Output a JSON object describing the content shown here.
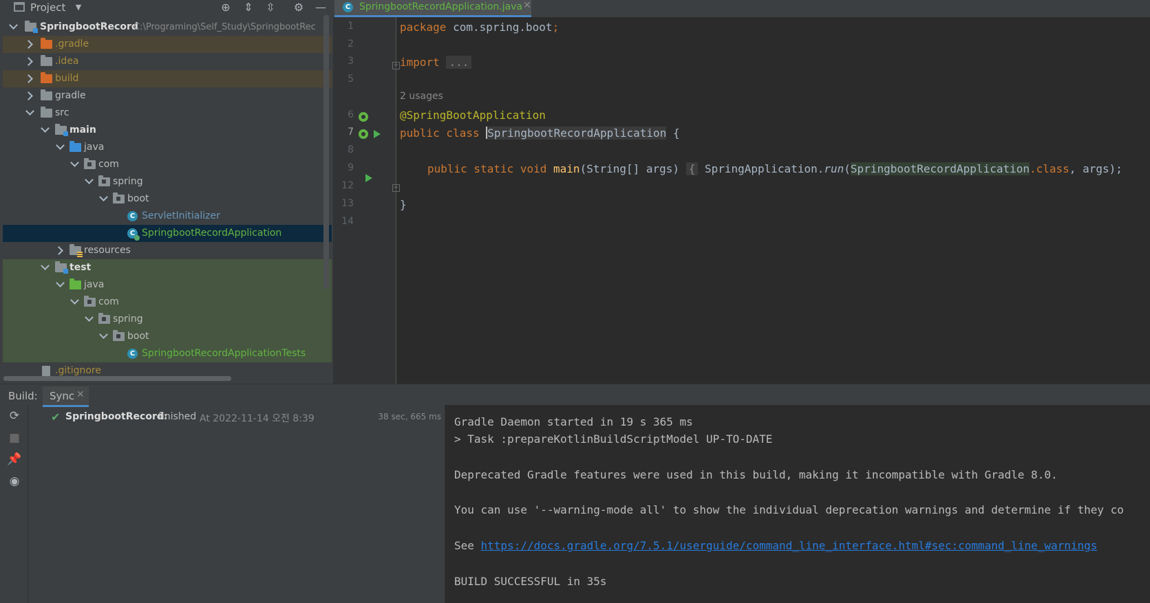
{
  "project_panel": {
    "title": "Project",
    "tree": {
      "root_name": "SpringbootRecord",
      "root_path": "C:\\Programing\\Self_Study\\SpringbootRec",
      "items": {
        "gradle_hidden": ".gradle",
        "idea": ".idea",
        "build": "build",
        "gradle": "gradle",
        "src": "src",
        "main": "main",
        "main_java": "java",
        "main_com": "com",
        "main_spring": "spring",
        "main_boot": "boot",
        "servlet_initializer": "ServletInitializer",
        "app_class": "SpringbootRecordApplication",
        "resources": "resources",
        "test": "test",
        "test_java": "java",
        "test_com": "com",
        "test_spring": "spring",
        "test_boot": "boot",
        "test_class": "SpringbootRecordApplicationTests",
        "gitignore": ".gitignore"
      }
    }
  },
  "editor": {
    "tab_title": "SpringbootRecordApplication.java",
    "line_numbers": [
      "1",
      "2",
      "3",
      "5",
      "6",
      "7",
      "8",
      "9",
      "12",
      "13",
      "14"
    ],
    "usages_hint": "2 usages",
    "code": {
      "kw_package": "package",
      "package_name": " com.spring.boot",
      "semicolon": ";",
      "kw_import": "import",
      "import_collapsed": "...",
      "annotation": "@SpringBootApplication",
      "kw_public_class": "public class ",
      "class_name": "SpringbootRecordApplication",
      "open_brace": " {",
      "kw_main_mods": "public static void ",
      "main_name": "main",
      "main_params": "(String[] args) ",
      "main_body_open": "{",
      "spring_app": " SpringApplication.",
      "run_call": "run",
      "paren_open": "(",
      "class_ref": "SpringbootRecordApplication",
      "dot_class": ".class",
      "call_rest": ", args);",
      "close_brace": "}"
    }
  },
  "build_panel": {
    "label": "Build:",
    "tab_sync": "Sync",
    "result_name": "SpringbootRecord:",
    "result_status": "finished",
    "result_time": "At 2022-11-14 오전 8:39",
    "result_duration": "38 sec, 665 ms",
    "console": {
      "line1": "Gradle Daemon started in 19 s 365 ms",
      "line2": "> Task :prepareKotlinBuildScriptModel UP-TO-DATE",
      "line3": "Deprecated Gradle features were used in this build, making it incompatible with Gradle 8.0.",
      "line4": "You can use '--warning-mode all' to show the individual deprecation warnings and determine if they co",
      "line5_prefix": "See ",
      "line5_link": "https://docs.gradle.org/7.5.1/userguide/command_line_interface.html#sec:command_line_warnings",
      "line6": "BUILD SUCCESSFUL in 35s"
    }
  },
  "colors": {
    "keyword": "#cc7832",
    "annotation": "#bbb529",
    "function": "#ffc66d",
    "selection": "#0d293e",
    "accent": "#4a88c7",
    "success": "#59a869",
    "link": "#287bde"
  }
}
